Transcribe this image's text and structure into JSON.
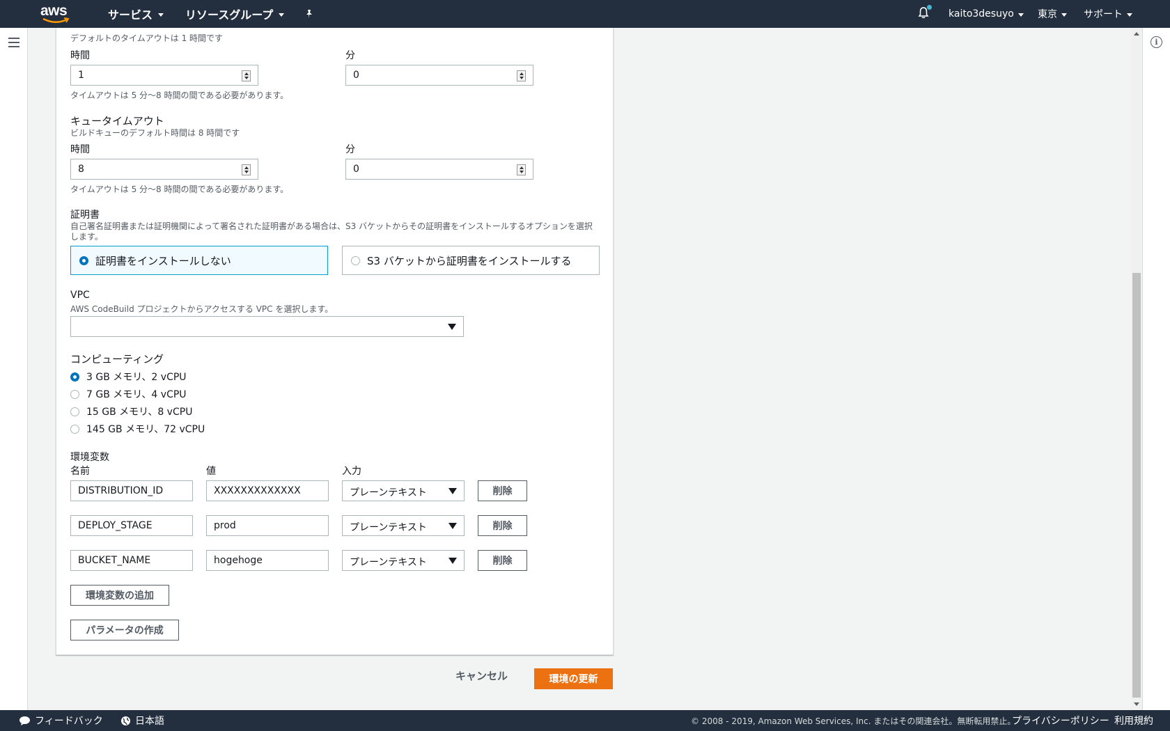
{
  "nav": {
    "logo_text": "aws",
    "services": "サービス",
    "resource_groups": "リソースグループ",
    "user": "kaito3desuyo",
    "region": "東京",
    "support": "サポート"
  },
  "timeout": {
    "description": "デフォルトのタイムアウトは 1 時間です",
    "hours_label": "時間",
    "minutes_label": "分",
    "hours_value": "1",
    "minutes_value": "0",
    "hint": "タイムアウトは 5 分〜8 時間の間である必要があります。"
  },
  "queue_timeout": {
    "title": "キュータイムアウト",
    "description": "ビルドキューのデフォルト時間は 8 時間です",
    "hours_label": "時間",
    "minutes_label": "分",
    "hours_value": "8",
    "minutes_value": "0",
    "hint": "タイムアウトは 5 分〜8 時間の間である必要があります。"
  },
  "certificate": {
    "title": "証明書",
    "description_line1": "自己署名証明書または証明機関によって署名された証明書がある場合は、S3 バケットからその証明書をインストールするオプションを選択",
    "description_line2": "します。",
    "option_none": "証明書をインストールしない",
    "option_s3": "S3 バケットから証明書をインストールする"
  },
  "vpc": {
    "title": "VPC",
    "description": "AWS CodeBuild プロジェクトからアクセスする VPC を選択します。",
    "selected": ""
  },
  "compute": {
    "title": "コンピューティング",
    "options": [
      "3 GB メモリ、2 vCPU",
      "7 GB メモリ、4 vCPU",
      "15 GB メモリ、8 vCPU",
      "145 GB メモリ、72 vCPU"
    ],
    "selected_index": 0
  },
  "env": {
    "title": "環境変数",
    "col_name": "名前",
    "col_value": "値",
    "col_type": "入力",
    "rows": [
      {
        "name": "DISTRIBUTION_ID",
        "value": "XXXXXXXXXXXXX",
        "type": "プレーンテキスト",
        "delete": "削除"
      },
      {
        "name": "DEPLOY_STAGE",
        "value": "prod",
        "type": "プレーンテキスト",
        "delete": "削除"
      },
      {
        "name": "BUCKET_NAME",
        "value": "hogehoge",
        "type": "プレーンテキスト",
        "delete": "削除"
      }
    ],
    "add_button": "環境変数の追加",
    "param_button": "パラメータの作成"
  },
  "actions": {
    "cancel": "キャンセル",
    "update": "環境の更新"
  },
  "footer": {
    "feedback": "フィードバック",
    "language": "日本語",
    "copyright": "© 2008 - 2019, Amazon Web Services, Inc. またはその関連会社。無断転用禁止。",
    "privacy": "プライバシーポリシー",
    "terms": "利用規約"
  },
  "colors": {
    "nav_bg": "#232f3e",
    "primary": "#ec7211",
    "radio_selected": "#0073bb",
    "tile_selected_border": "#00a1c9"
  }
}
